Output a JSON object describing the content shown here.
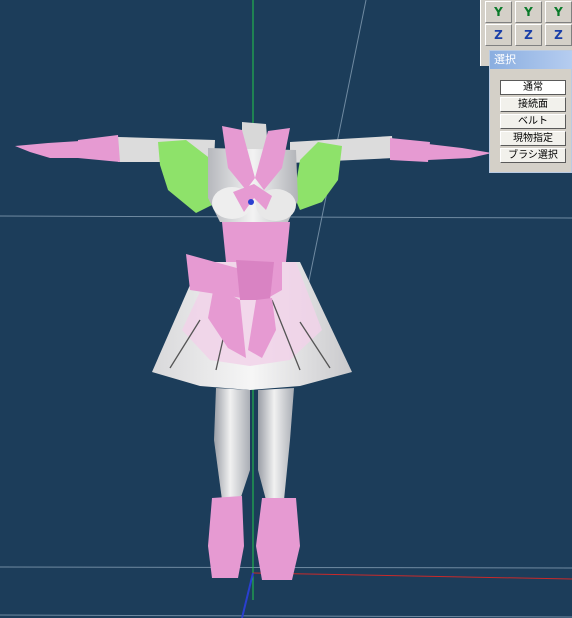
{
  "axis_buttons": {
    "row1": [
      "Y",
      "Y",
      "Y"
    ],
    "row2": [
      "Z",
      "Z",
      "Z"
    ]
  },
  "select_panel": {
    "title": "選択",
    "buttons": [
      "通常",
      "接続面",
      "ベルト",
      "現物指定",
      "ブラシ選択"
    ],
    "active_index": 0
  },
  "colors": {
    "viewport_background": "#1c3d5a",
    "skin": "#e3e3e3",
    "pink": "#e69ad2",
    "green_sleeve": "#8ee26a",
    "axis_y": "#22c84a",
    "axis_z": "#2a3fd0",
    "axis_x": "#c82a2a"
  }
}
